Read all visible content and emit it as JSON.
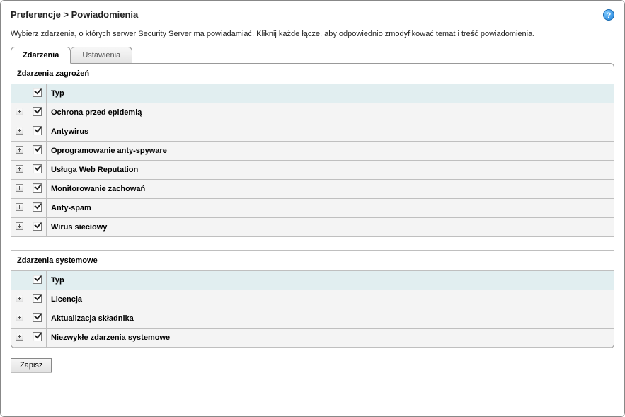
{
  "breadcrumb": "Preferencje > Powiadomienia",
  "help_icon": "?",
  "intro": "Wybierz zdarzenia, o których serwer Security Server ma powiadamiać. Kliknij każde łącze, aby odpowiednio zmodyfikować temat i treść powiadomienia.",
  "tabs": {
    "events": "Zdarzenia",
    "settings": "Ustawienia"
  },
  "threat_section": {
    "title": "Zdarzenia zagrożeń",
    "type_header": "Typ",
    "rows": [
      {
        "label": "Ochrona przed epidemią",
        "checked": true
      },
      {
        "label": "Antywirus",
        "checked": true
      },
      {
        "label": "Oprogramowanie anty-spyware",
        "checked": true
      },
      {
        "label": "Usługa Web Reputation",
        "checked": true
      },
      {
        "label": "Monitorowanie zachowań",
        "checked": true
      },
      {
        "label": "Anty-spam",
        "checked": true
      },
      {
        "label": "Wirus sieciowy",
        "checked": true
      }
    ]
  },
  "system_section": {
    "title": "Zdarzenia systemowe",
    "type_header": "Typ",
    "rows": [
      {
        "label": "Licencja",
        "checked": true
      },
      {
        "label": "Aktualizacja składnika",
        "checked": true
      },
      {
        "label": "Niezwykłe zdarzenia systemowe",
        "checked": true
      }
    ]
  },
  "buttons": {
    "save": "Zapisz"
  }
}
